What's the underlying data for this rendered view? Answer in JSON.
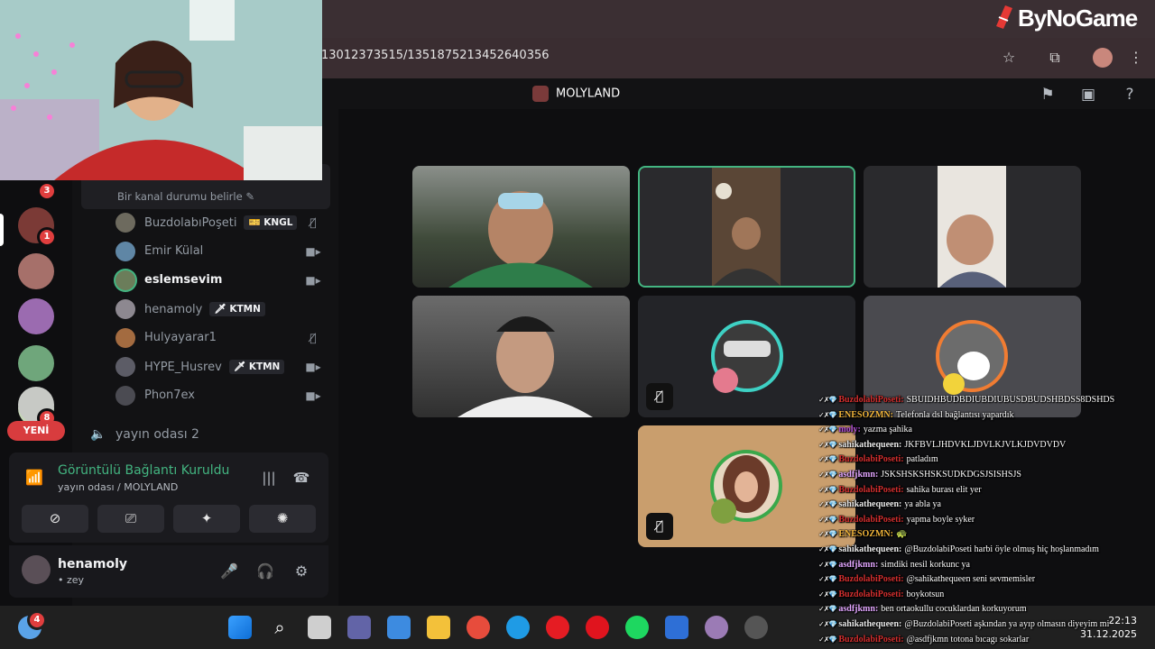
{
  "browser": {
    "url": "13012373515/1351875213452640356",
    "star_icon": "star-icon",
    "ext_icon": "puzzle-icon",
    "menu_icon": "kebab-icon"
  },
  "watermark": {
    "text": "ByNoGame"
  },
  "discord": {
    "server_name": "MOLYLAND",
    "channel_status_placeholder": "Bir kanal durumu belirle",
    "channel_header": "yayın o",
    "members": [
      {
        "name": "BuzdolabıPoşeti",
        "tag": "KNGL",
        "tag_icon": "🎫",
        "right_icon": "mic-muted-icon",
        "bright": false
      },
      {
        "name": "Emir Külal",
        "tag": "",
        "tag_icon": "",
        "right_icon": "video-icon",
        "bright": false
      },
      {
        "name": "eslemsevim",
        "tag": "",
        "tag_icon": "",
        "right_icon": "video-icon",
        "bright": true
      },
      {
        "name": "henamoly",
        "tag": "KTMN",
        "tag_icon": "🗡",
        "right_icon": "",
        "bright": false
      },
      {
        "name": "Hulyayarar1",
        "tag": "",
        "tag_icon": "",
        "right_icon": "mic-muted-icon",
        "bright": false
      },
      {
        "name": "HYPE_Husrev",
        "tag": "KTMN",
        "tag_icon": "🗡",
        "right_icon": "video-icon",
        "bright": false
      },
      {
        "name": "Phon7ex",
        "tag": "",
        "tag_icon": "",
        "right_icon": "video-icon",
        "bright": false
      }
    ],
    "voice_channel_2": "yayın odası 2",
    "connection": {
      "title": "Görüntülü Bağlantı Kuruldu",
      "subtitle": "yayın odası / MOLYLAND"
    },
    "user": {
      "name": "henamoly",
      "status": "• zey"
    },
    "guild_badges": [
      "3",
      "1",
      "8"
    ],
    "new_label": "YENİ"
  },
  "taskbar": {
    "weather_badge": "4",
    "time": "22:13",
    "date": "31.12.2025"
  },
  "chat": [
    {
      "user": "BuzdolabiPoseti:",
      "color": "#d32f2f",
      "msg": "SBUIDHBUDBDIUBDIUBUSDBUDSHBDSS8DSHDS"
    },
    {
      "user": "ENESOZMN:",
      "color": "#f0b43a",
      "msg": "Telefonla dsl bağlantısı yapardık"
    },
    {
      "user": "moly:",
      "color": "#b14fd8",
      "msg": "yazma şahika"
    },
    {
      "user": "sahikathequeen:",
      "color": "#e8e8e8",
      "msg": "JKFBVLJHDVKLJDVLKJVLKJDVDVDV"
    },
    {
      "user": "BuzdolabiPoseti:",
      "color": "#d32f2f",
      "msg": "patladım"
    },
    {
      "user": "asdfjkmn:",
      "color": "#e2a6ff",
      "msg": "JSKSHSKSHSKSUDKDGSJSISHSJS"
    },
    {
      "user": "BuzdolabiPoseti:",
      "color": "#d32f2f",
      "msg": "sahika burası elit yer"
    },
    {
      "user": "sahikathequeen:",
      "color": "#e8e8e8",
      "msg": "ya abla ya"
    },
    {
      "user": "BuzdolabiPoseti:",
      "color": "#d32f2f",
      "msg": "yapma boyle syker"
    },
    {
      "user": "ENESOZMN:",
      "color": "#f0b43a",
      "msg": "🐢"
    },
    {
      "user": "sahikathequeen:",
      "color": "#e8e8e8",
      "msg": "@BuzdolabiPoseti harbi öyle olmuş hiç hoşlanmadım"
    },
    {
      "user": "asdfjkmn:",
      "color": "#e2a6ff",
      "msg": "simdiki nesil korkunc ya"
    },
    {
      "user": "BuzdolabiPoseti:",
      "color": "#d32f2f",
      "msg": "@sahikathequeen seni sevmemisler"
    },
    {
      "user": "BuzdolabiPoseti:",
      "color": "#d32f2f",
      "msg": "boykotsun"
    },
    {
      "user": "asdfjkmn:",
      "color": "#e2a6ff",
      "msg": "ben ortaokullu cocuklardan korkuyorum"
    },
    {
      "user": "sahikathequeen:",
      "color": "#e8e8e8",
      "msg": "@BuzdolabiPoseti aşkından ya ayıp olmasın diyeyim mi"
    },
    {
      "user": "BuzdolabiPoseti:",
      "color": "#d32f2f",
      "msg": "@asdfjkmn totona bıcagı sokarlar"
    }
  ]
}
